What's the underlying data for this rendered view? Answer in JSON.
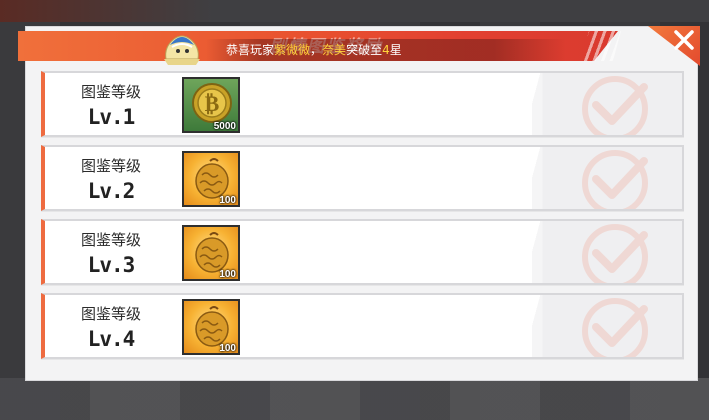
{
  "dialog": {
    "title": "剧情图鉴奖励",
    "announce": {
      "prefix": "恭喜玩家",
      "player": "紫微微",
      "sep": "，",
      "character": "奈美",
      "action": "突破至",
      "stars": "4",
      "suffix": "星"
    },
    "close_icon": "close-icon"
  },
  "rows": [
    {
      "label": "图鉴等级",
      "level": "Lv.1",
      "reward": {
        "icon": "coin-icon",
        "count": "5000",
        "bg": "green"
      },
      "claimed": true
    },
    {
      "label": "图鉴等级",
      "level": "Lv.2",
      "reward": {
        "icon": "devil-fruit-icon",
        "count": "100",
        "bg": "orange"
      },
      "claimed": true
    },
    {
      "label": "图鉴等级",
      "level": "Lv.3",
      "reward": {
        "icon": "devil-fruit-icon",
        "count": "100",
        "bg": "orange"
      },
      "claimed": true
    },
    {
      "label": "图鉴等级",
      "level": "Lv.4",
      "reward": {
        "icon": "devil-fruit-icon",
        "count": "100",
        "bg": "orange"
      },
      "claimed": true
    }
  ],
  "colors": {
    "accent": "#ee6b40",
    "highlight": "#ffd23a",
    "check": "#f0b8ab"
  }
}
